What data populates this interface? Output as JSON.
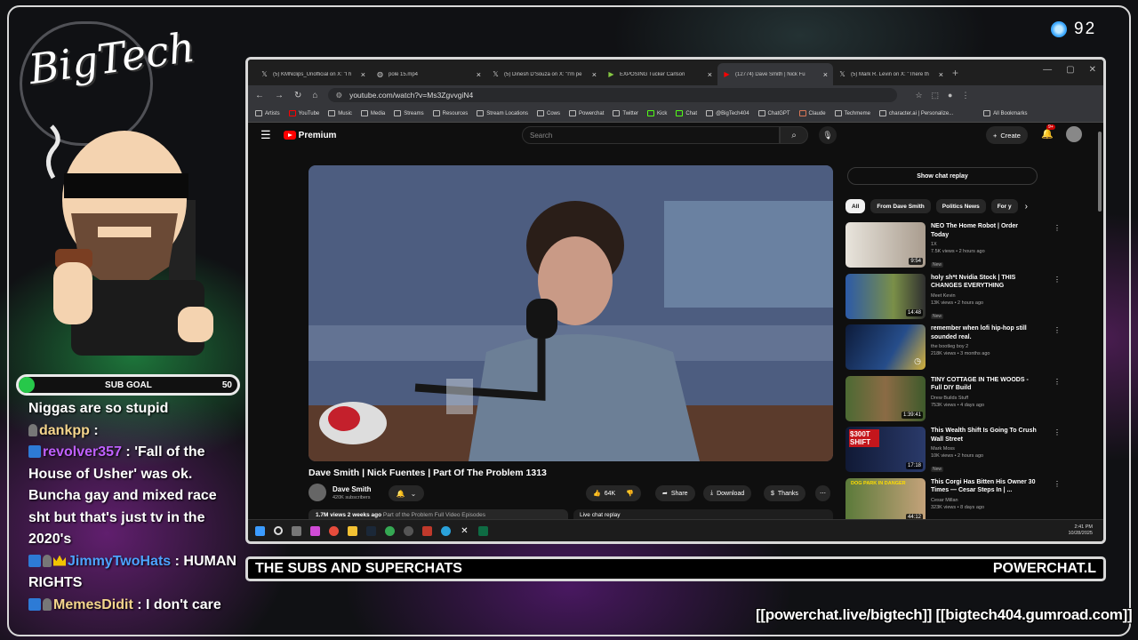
{
  "overlay": {
    "logo_text": "BigTech",
    "viewer_count": "92",
    "sub_goal_label": "SUB GOAL",
    "sub_goal_value": "50",
    "ticker_left": "THE SUBS AND SUPERCHATS",
    "ticker_right": "POWERCHAT.L",
    "links": "[[powerchat.live/bigtech]] [[bigtech404.gumroad.com]]",
    "chat": [
      {
        "user": "",
        "text": "Niggas are so stupid"
      },
      {
        "user": "dankpp",
        "text": ":"
      },
      {
        "user": "revolver357",
        "text": ": 'Fall of the House of Usher' was ok. Buncha gay and mixed race sht but that's just tv in the 2020's"
      },
      {
        "user": "JimmyTwoHats",
        "text": ": HUMAN RIGHTS"
      },
      {
        "user": "MemesDidit",
        "text": ": I don't care"
      }
    ]
  },
  "browser": {
    "tabs": [
      {
        "title": "(5) KMNclips_Unofficial on X: \"I h",
        "icon": "x-icon"
      },
      {
        "title": "pole 15.mp4",
        "icon": "globe-icon"
      },
      {
        "title": "(5) Dinesh D'Souza on X: \"I'm pe",
        "icon": "x-icon"
      },
      {
        "title": "EXPOSING Tucker Carlson",
        "icon": "rumble-icon"
      },
      {
        "title": "(12774) Dave Smith | Nick Fu",
        "icon": "youtube-icon"
      },
      {
        "title": "(5) Mark R. Levin on X: \"There th",
        "icon": "x-icon"
      }
    ],
    "url": "youtube.com/watch?v=Ms3ZgvvgiN4",
    "bookmarks": [
      "Artists",
      "YouTube",
      "Music",
      "Media",
      "Streams",
      "Resources",
      "Stream Locations",
      "Cows",
      "Powerchat",
      "Twitter",
      "Kick",
      "Chat",
      "@BigTech404",
      "ChatGPT",
      "Claude",
      "Techmeme",
      "character.ai | Personalize..."
    ],
    "all_bookmarks": "All Bookmarks"
  },
  "youtube": {
    "logo": "Premium",
    "search_placeholder": "Search",
    "create": "Create",
    "notif_count": "9+",
    "video_title": "Dave Smith | Nick Fuentes | Part Of The Problem 1313",
    "channel": "Dave Smith",
    "subscribers": "420K subscribers",
    "likes": "64K",
    "share": "Share",
    "download": "Download",
    "thanks": "Thanks",
    "views_line": "1.7M views  2 weeks ago",
    "playlist": "Part of the Problem Full Video Episodes",
    "live_chat_replay": "Live chat replay",
    "show_chat_replay": "Show chat replay",
    "chips": [
      "All",
      "From Dave Smith",
      "Politics News",
      "For y"
    ],
    "recommendations": [
      {
        "title": "NEO The Home Robot | Order Today",
        "channel": "1X",
        "meta": "7.5K views • 2 hours ago",
        "badge": "New",
        "duration": "9:54"
      },
      {
        "title": "holy sh*t Nvidia Stock | THIS CHANGES EVERYTHING",
        "channel": "Meet Kevin",
        "meta": "13K views • 2 hours ago",
        "badge": "New",
        "duration": "14:48"
      },
      {
        "title": "remember when lofi hip-hop still sounded real.",
        "channel": "the bootleg boy 2",
        "meta": "218K views • 3 months ago",
        "badge": "",
        "duration": ""
      },
      {
        "title": "TINY COTTAGE IN THE WOODS - Full DIY Build",
        "channel": "Drew Builds Stuff",
        "meta": "753K views • 4 days ago",
        "badge": "",
        "duration": "1:39:41"
      },
      {
        "title": "This Wealth Shift Is Going To Crush Wall Street",
        "channel": "Mark Moss",
        "meta": "10K views • 2 hours ago",
        "badge": "New",
        "duration": "17:18",
        "thumb_text": "$300T SHIFT"
      },
      {
        "title": "This Corgi Has Bitten His Owner 30 Times — Cesar Steps In | ...",
        "channel": "Cesar Millan",
        "meta": "323K views • 8 days ago",
        "badge": "",
        "duration": "44:12",
        "thumb_text": "DOG PARK IN DANGER"
      }
    ]
  },
  "taskbar": {
    "time": "2:41 PM",
    "date": "10/28/2025"
  }
}
